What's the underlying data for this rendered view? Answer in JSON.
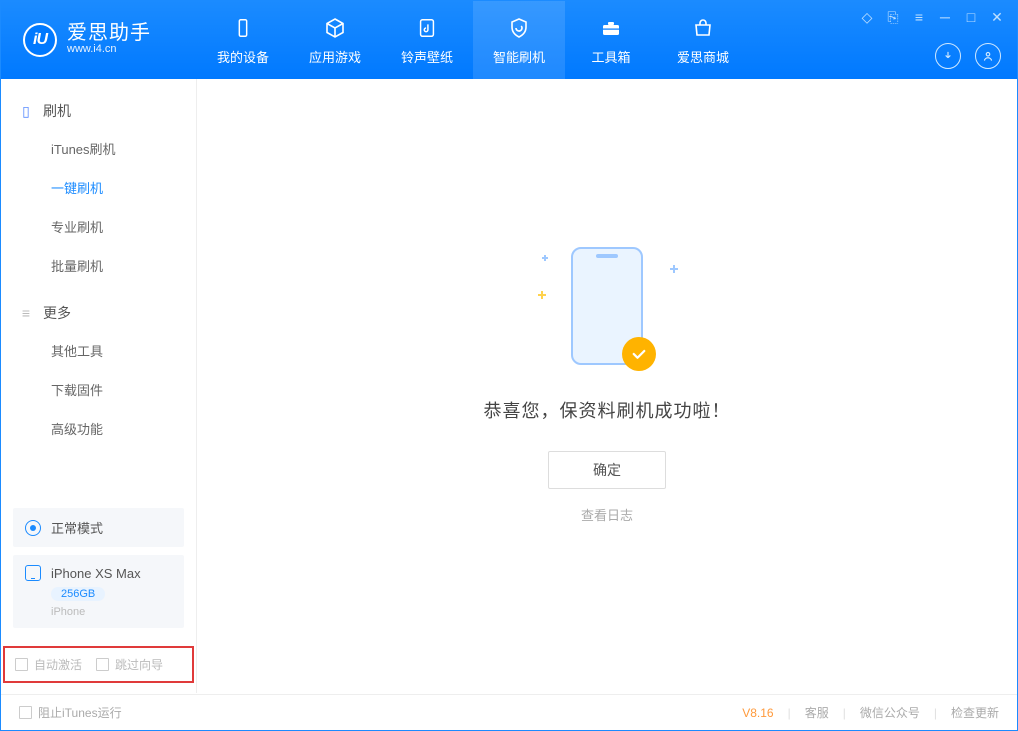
{
  "app": {
    "name_cn": "爱思助手",
    "name_en": "www.i4.cn"
  },
  "nav": {
    "items": [
      {
        "label": "我的设备"
      },
      {
        "label": "应用游戏"
      },
      {
        "label": "铃声壁纸"
      },
      {
        "label": "智能刷机"
      },
      {
        "label": "工具箱"
      },
      {
        "label": "爱思商城"
      }
    ],
    "active_index": 3
  },
  "sidebar": {
    "group1": {
      "title": "刷机",
      "items": [
        "iTunes刷机",
        "一键刷机",
        "专业刷机",
        "批量刷机"
      ],
      "active_index": 1
    },
    "group2": {
      "title": "更多",
      "items": [
        "其他工具",
        "下载固件",
        "高级功能"
      ]
    },
    "status_mode": "正常模式",
    "device": {
      "name": "iPhone XS Max",
      "storage": "256GB",
      "type": "iPhone"
    },
    "opts": {
      "auto_activate": "自动激活",
      "skip_guide": "跳过向导"
    }
  },
  "main": {
    "success_msg": "恭喜您，保资料刷机成功啦！",
    "ok_btn": "确定",
    "view_log": "查看日志"
  },
  "footer": {
    "block_itunes": "阻止iTunes运行",
    "version": "V8.16",
    "links": [
      "客服",
      "微信公众号",
      "检查更新"
    ]
  }
}
